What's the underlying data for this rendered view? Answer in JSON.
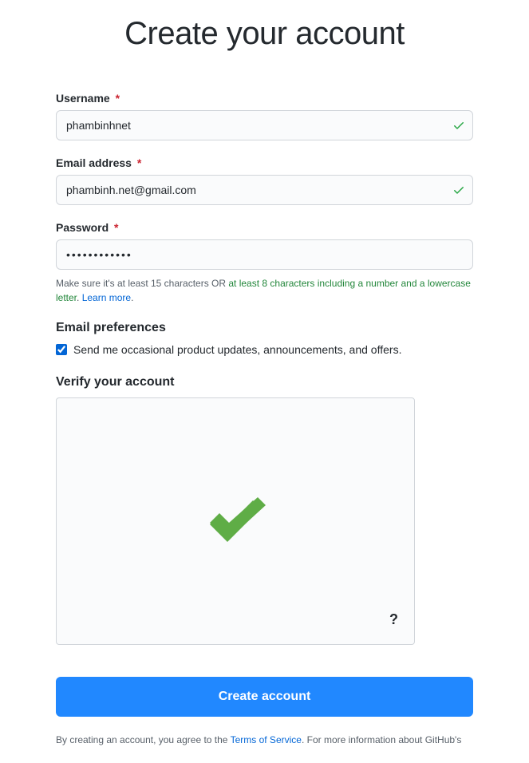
{
  "title": "Create your account",
  "form": {
    "username": {
      "label": "Username",
      "value": "phambinhnet",
      "valid": true
    },
    "email": {
      "label": "Email address",
      "value": "phambinh.net@gmail.com",
      "valid": true
    },
    "password": {
      "label": "Password",
      "value": "••••••••••••",
      "hint_prefix": "Make sure it's at least 15 characters OR ",
      "hint_green": "at least 8 characters including a number and a lowercase letter",
      "hint_period": ". ",
      "hint_link": "Learn more",
      "hint_suffix": "."
    }
  },
  "email_prefs": {
    "heading": "Email preferences",
    "checkbox_label": "Send me occasional product updates, announcements, and offers.",
    "checked": true
  },
  "verify": {
    "heading": "Verify your account",
    "help": "?"
  },
  "submit": {
    "label": "Create account"
  },
  "legal": {
    "prefix": "By creating an account, you agree to the ",
    "tos_link": "Terms of Service",
    "suffix": ". For more information about GitHub's"
  }
}
